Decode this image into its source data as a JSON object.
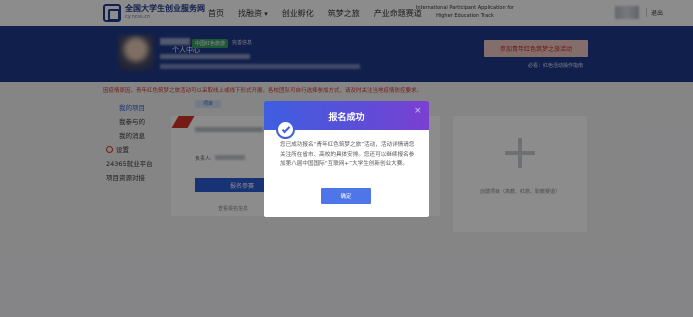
{
  "topbar": {
    "logo_cn": "全国大学生创业服务网",
    "logo_en": "cy.ncss.cn",
    "nav": [
      "首页",
      "找融资",
      "创业孵化",
      "筑梦之旅",
      "产业命题赛道"
    ],
    "nav_en": "International Participant Application for Higher Education Track",
    "logout": "退出"
  },
  "banner": {
    "center_label": "个人中心",
    "tag": "中国红色旅游",
    "tag2": "完善信息",
    "cta": "参加青年红色筑梦之旅活动",
    "note": "必看：红色活动操作指南"
  },
  "notice": "因疫情原因，青年红色筑梦之旅活动可以采取线上或线下形式开展，各校团队可自行选择参加方式，请及时关注当地疫情防控要求。",
  "sidebar": {
    "items": [
      "我的项目",
      "我参与的",
      "我的消息",
      "设置",
      "24365就业平台",
      "项目资源对接"
    ]
  },
  "content": {
    "tab": "项目",
    "person_label": "负责人:",
    "primary_btn": "报名参赛",
    "link": "查看报名信息",
    "create_text": "创建项目（高教、红旅、职教赛道）"
  },
  "modal": {
    "title": "报名成功",
    "body": "您已成功报名“青年红色筑梦之旅”活动，活动详情请您关注所在省市、高校的具体安排。您还可以继续报名参加第八届中国国际“互联网+”大学生创新创业大赛。",
    "confirm": "确定",
    "close": "×"
  },
  "colors": {
    "primary": "#2d5cd7",
    "banner": "#1f3a8a",
    "alert": "#d5342a"
  }
}
